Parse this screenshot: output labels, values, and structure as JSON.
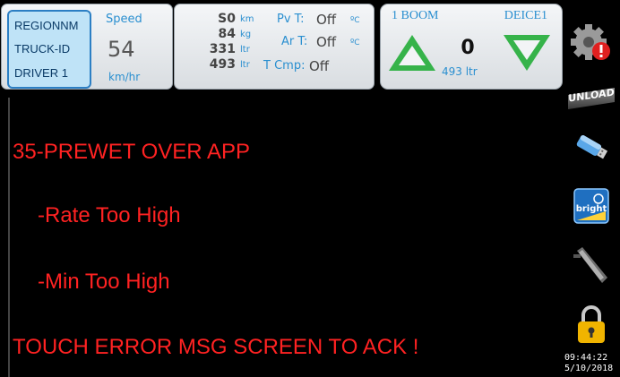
{
  "vehicle": {
    "region": "REGIONNM",
    "truck_id": "TRUCK-ID",
    "driver": "DRIVER 1"
  },
  "speed": {
    "label": "Speed",
    "value": "54",
    "unit": "km/hr"
  },
  "rates": [
    {
      "value": "S0",
      "unit": "km"
    },
    {
      "value": "84",
      "unit": "kg"
    },
    {
      "value": "331",
      "unit": "ltr"
    },
    {
      "value": "493",
      "unit": "ltr"
    }
  ],
  "temps": [
    {
      "label": "Pv T:",
      "value": "Off",
      "unit": "ºC"
    },
    {
      "label": "Ar T:",
      "value": "Off",
      "unit": "ºC"
    },
    {
      "label": "T Cmp:",
      "value": "Off"
    }
  ],
  "boom": {
    "label": "1 BOOM",
    "deice": "DEICE1",
    "count": "0",
    "volume": "493 ltr"
  },
  "message": {
    "title": "35-PREWET OVER APP",
    "line1": "-Rate Too High",
    "line2": "-Min Too High",
    "ack": "TOUCH ERROR MSG SCREEN TO ACK !"
  },
  "sidebar": {
    "unload_label": "UNLOAD",
    "bright_label": "bright"
  },
  "clock": {
    "time": "09:44:22",
    "date": "5/10/2018"
  },
  "colors": {
    "message": "#ff2222",
    "accent": "#2a8fd0",
    "arrow_green": "#36b34a",
    "alert_red": "#e02020"
  }
}
